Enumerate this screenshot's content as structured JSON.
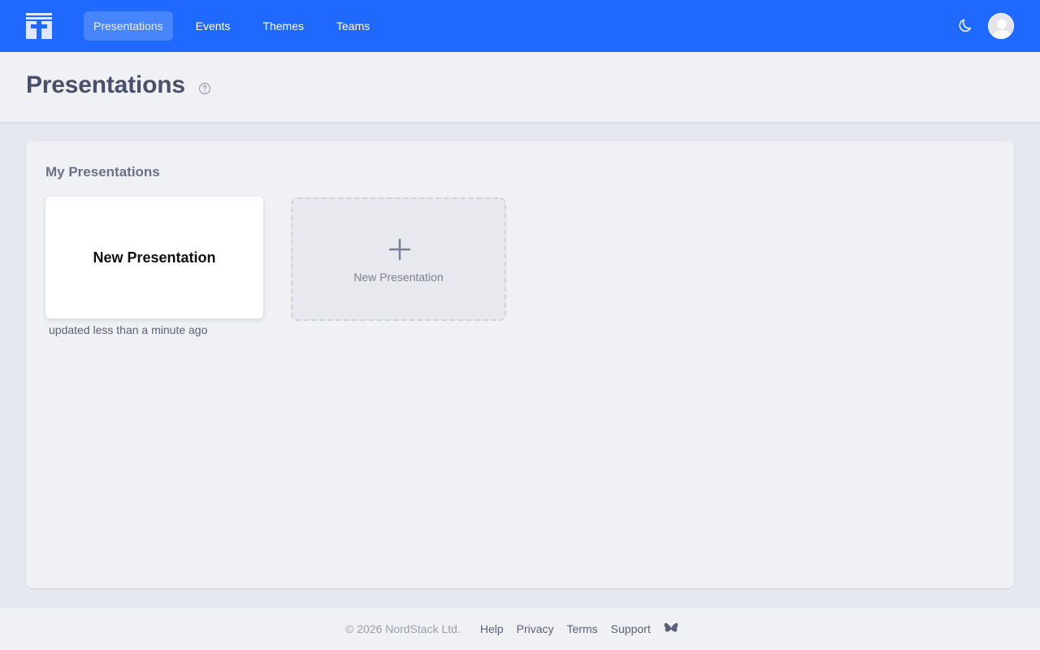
{
  "nav": {
    "items": [
      {
        "label": "Presentations",
        "active": true
      },
      {
        "label": "Events"
      },
      {
        "label": "Themes"
      },
      {
        "label": "Teams"
      }
    ],
    "brand_color": "#1f69ff"
  },
  "header": {
    "title": "Presentations"
  },
  "main": {
    "section_title": "My Presentations",
    "presentations": [
      {
        "title": "New Presentation",
        "updated": "updated less than a minute ago"
      }
    ],
    "new_card_label": "New Presentation"
  },
  "footer": {
    "copyright": "© 2026 NordStack Ltd.",
    "links": [
      "Help",
      "Privacy",
      "Terms",
      "Support"
    ]
  },
  "icons": [
    "logo-icon",
    "moon-icon",
    "avatar",
    "help-circle-icon",
    "plus-icon",
    "butterfly-icon"
  ]
}
